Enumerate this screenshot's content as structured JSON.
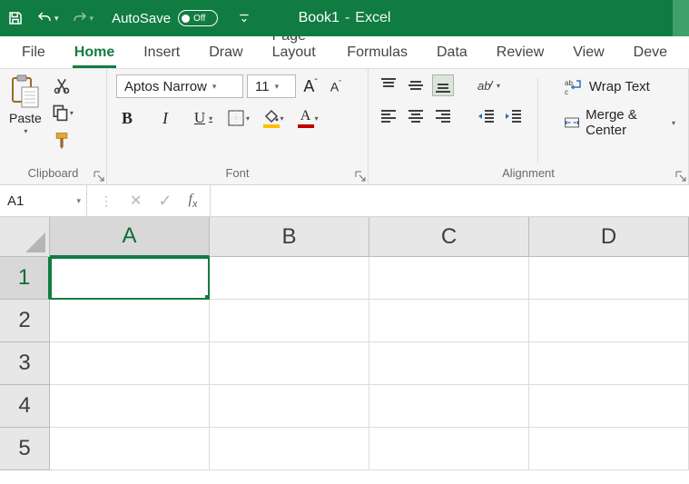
{
  "titlebar": {
    "autosave_label": "AutoSave",
    "autosave_state": "Off",
    "doc_name": "Book1",
    "app_name": "Excel",
    "separator": "-"
  },
  "tabs": [
    "File",
    "Home",
    "Insert",
    "Draw",
    "Page Layout",
    "Formulas",
    "Data",
    "Review",
    "View",
    "Deve"
  ],
  "active_tab": "Home",
  "ribbon": {
    "clipboard": {
      "paste": "Paste",
      "label": "Clipboard"
    },
    "font": {
      "name": "Aptos Narrow",
      "size": "11",
      "label": "Font",
      "fill_color": "#FFC000",
      "font_color": "#C00000"
    },
    "alignment": {
      "label": "Alignment",
      "wrap": "Wrap Text",
      "merge": "Merge & Center"
    }
  },
  "formula_bar": {
    "name_box": "A1",
    "formula": ""
  },
  "grid": {
    "columns": [
      "A",
      "B",
      "C",
      "D"
    ],
    "rows": [
      "1",
      "2",
      "3",
      "4",
      "5"
    ],
    "active_cell": "A1"
  }
}
